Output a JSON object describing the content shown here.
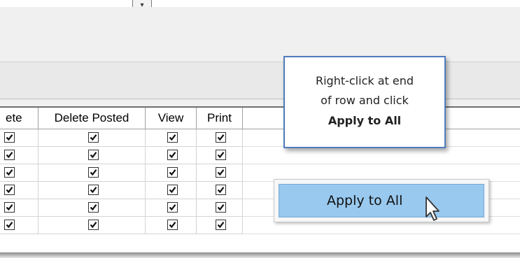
{
  "top": {
    "dropdown_arrow": "▾"
  },
  "grid": {
    "columns": [
      {
        "key": "delete",
        "label": "ete"
      },
      {
        "key": "delete_posted",
        "label": "Delete Posted"
      },
      {
        "key": "view",
        "label": "View"
      },
      {
        "key": "print",
        "label": "Print"
      }
    ],
    "rows": [
      {
        "delete": true,
        "delete_posted": true,
        "view": true,
        "print": true
      },
      {
        "delete": true,
        "delete_posted": true,
        "view": true,
        "print": true
      },
      {
        "delete": true,
        "delete_posted": true,
        "view": true,
        "print": true
      },
      {
        "delete": true,
        "delete_posted": true,
        "view": true,
        "print": true
      },
      {
        "delete": true,
        "delete_posted": true,
        "view": true,
        "print": true
      },
      {
        "delete": true,
        "delete_posted": true,
        "view": true,
        "print": true
      }
    ]
  },
  "callout": {
    "line1": "Right-click at end",
    "line2": "of row and click",
    "line3": "Apply to All"
  },
  "context_menu": {
    "items": [
      {
        "label": "Apply to All"
      }
    ]
  },
  "colors": {
    "callout_border": "#4f7bbd",
    "menu_highlight": "#99c9ef"
  },
  "icons": {
    "cursor": "arrow-cursor-icon",
    "checkbox": "checkmark-icon"
  }
}
